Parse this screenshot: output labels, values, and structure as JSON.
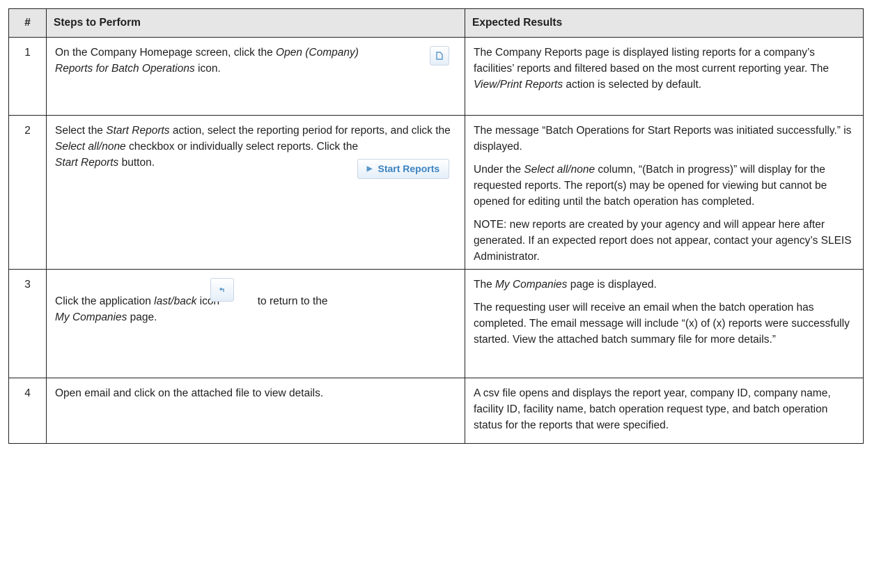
{
  "table": {
    "headers": {
      "num": "#",
      "steps": "Steps to Perform",
      "results": "Expected Results"
    },
    "rows": [
      {
        "num": "1",
        "step": {
          "p1": "On the Company Homepage screen, click the ",
          "em1": "Open (Company) Reports for Batch Operations",
          "p2": " icon."
        },
        "results": [
          {
            "t1": "The Company Reports page is displayed listing reports for a company’s facilities’ reports and filtered based on the most current reporting year. The ",
            "em1": "View/Print Reports",
            "t2": " action is selected by default."
          }
        ]
      },
      {
        "num": "2",
        "step": {
          "p1": "Select the ",
          "em1": "Start Reports",
          "p2": " action, select the reporting period for reports, and click the ",
          "em2": "Select all/none",
          "p3": " checkbox or individually select reports. Click the ",
          "em3": "Start Reports",
          "p4": " button.",
          "button_label": "Start Reports"
        },
        "results": [
          {
            "t1": "The message “Batch Operations for Start Reports was initiated successfully.” is displayed."
          },
          {
            "t1": "Under the ",
            "em1": "Select all/none",
            "t2": " column, “(Batch in progress)” will display for the requested reports. The report(s) may be opened for viewing but cannot be opened for editing until the batch operation has completed."
          },
          {
            "t1": "NOTE: new reports are created by your agency and will appear here after generated. If an expected report does not appear, contact your agency’s SLEIS Administrator."
          }
        ]
      },
      {
        "num": "3",
        "step": {
          "p1": "Click the application ",
          "em1": "last/back",
          "p2": " icon ",
          "p3": " to return to the ",
          "em2": "My Companies",
          "p4": " page."
        },
        "results": [
          {
            "t1": "The ",
            "em1": "My Companies",
            "t2": " page is displayed."
          },
          {
            "t1": "The requesting user will receive an email when the batch operation has completed. The email message will include “(x) of (x) reports were successfully started. View the attached batch summary file for more details.”"
          }
        ]
      },
      {
        "num": "4",
        "step": {
          "p1": "Open email and click on the attached file to view details."
        },
        "results": [
          {
            "t1": "A csv file opens and displays the report year, company ID, company name, facility ID, facility name, batch operation request type, and batch operation status for the reports that were specified."
          }
        ]
      }
    ]
  },
  "icons": {
    "open_reports": "document-icon",
    "start_reports": "play-icon",
    "back": "back-arrow-icon"
  },
  "colors": {
    "header_bg": "#e6e6e6",
    "icon_accent": "#3b83c0"
  }
}
